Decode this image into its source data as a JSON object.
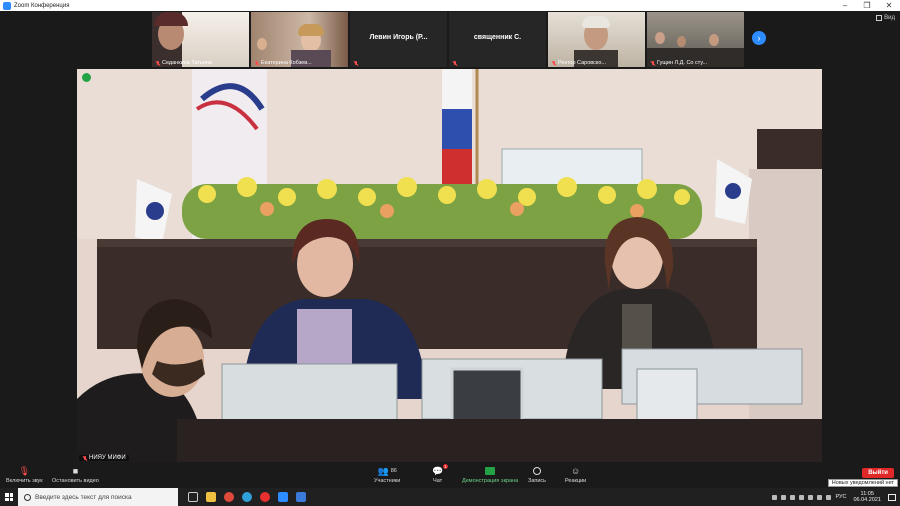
{
  "window": {
    "title": "Zoom Конференция"
  },
  "controls": {
    "minimize": "–",
    "maximize": "❐",
    "close": "✕"
  },
  "thumbnails": [
    {
      "name": "Седанкина Татьяна",
      "muted": true,
      "type": "video"
    },
    {
      "name": "Екатерина Кобзев...",
      "muted": true,
      "type": "video"
    },
    {
      "name": "Левин Игорь (Р...",
      "muted": true,
      "type": "name-only"
    },
    {
      "name": "священник С.",
      "muted": true,
      "type": "name-only"
    },
    {
      "name": "Ректор Саровско...",
      "muted": true,
      "type": "video"
    },
    {
      "name": "Гущин Л.Д. Со сту...",
      "muted": true,
      "type": "video"
    }
  ],
  "view_button": {
    "label": "Вид"
  },
  "main_video": {
    "speaker": "НИЯУ МИФИ"
  },
  "toolbar": {
    "mute": "Включить звук",
    "video": "Остановить видео",
    "participants": "Участники",
    "participants_count": "86",
    "chat": "Чат",
    "chat_badge": "1",
    "share": "Демонстрация экрана",
    "record": "Запись",
    "reactions": "Реакции",
    "leave": "Выйти",
    "notification": "Новых уведомлений нет"
  },
  "taskbar": {
    "search_placeholder": "Введите здесь текст для поиска",
    "language": "РУС",
    "time": "11:05",
    "date": "06.04.2021"
  },
  "colors": {
    "accent": "#2d8cff",
    "leave": "#e02828",
    "share": "#23a346"
  }
}
